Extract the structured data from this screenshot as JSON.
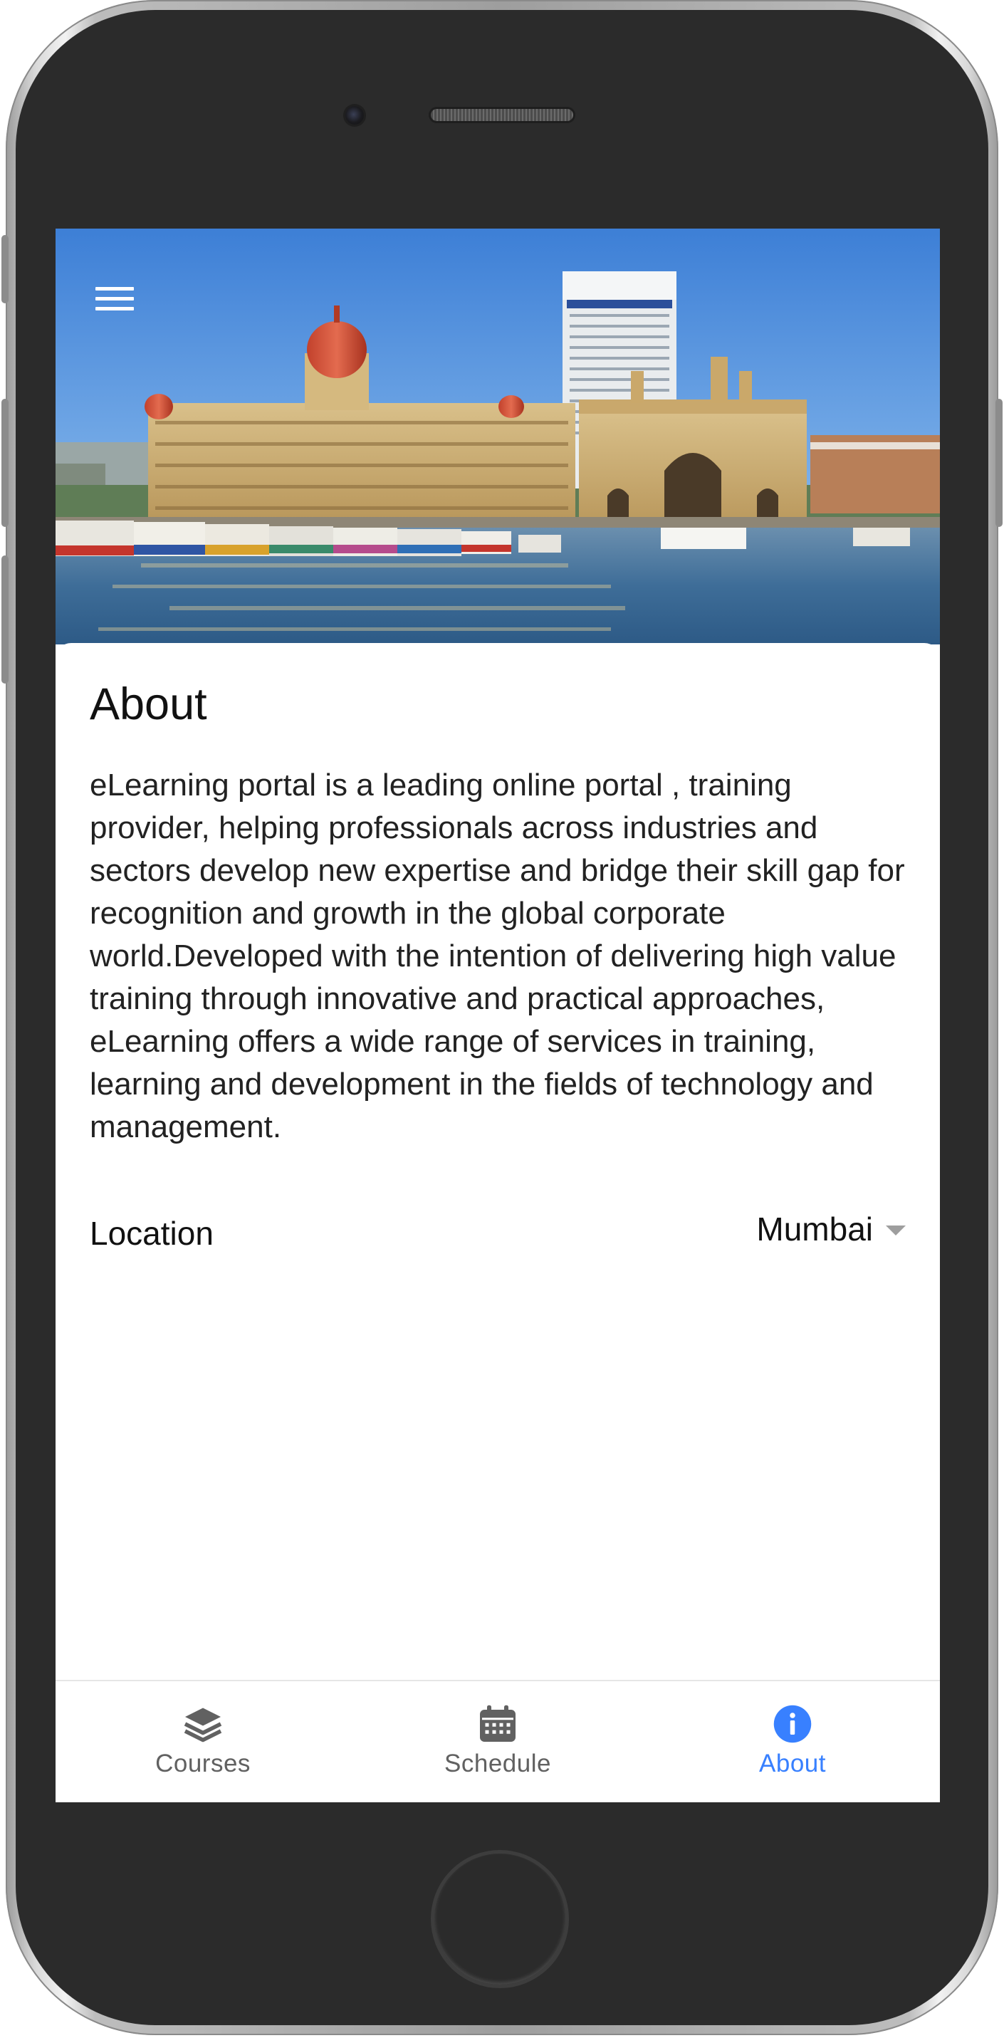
{
  "header": {
    "menu_icon": "hamburger-menu-icon",
    "hero_image": "Mumbai skyline with Taj Mahal Palace hotel, Gateway of India and boats in the harbor"
  },
  "about": {
    "title": "About",
    "description": "eLearning portal is a leading online portal , training provider, helping professionals across industries and sectors develop new expertise and bridge their skill gap for recognition and growth in the global corporate world.Developed with the intention of delivering high value training through innovative and practical approaches, eLearning offers a wide range of services in training, learning and development in the fields of technology and management.",
    "location_label": "Location",
    "location_value": "Mumbai"
  },
  "tabs": [
    {
      "label": "Courses",
      "icon": "layers-icon",
      "active": false
    },
    {
      "label": "Schedule",
      "icon": "calendar-icon",
      "active": false
    },
    {
      "label": "About",
      "icon": "info-circle-icon",
      "active": true
    }
  ],
  "colors": {
    "accent": "#3880ff",
    "tab_inactive": "#616161",
    "phone_body": "#2b2b2b"
  }
}
